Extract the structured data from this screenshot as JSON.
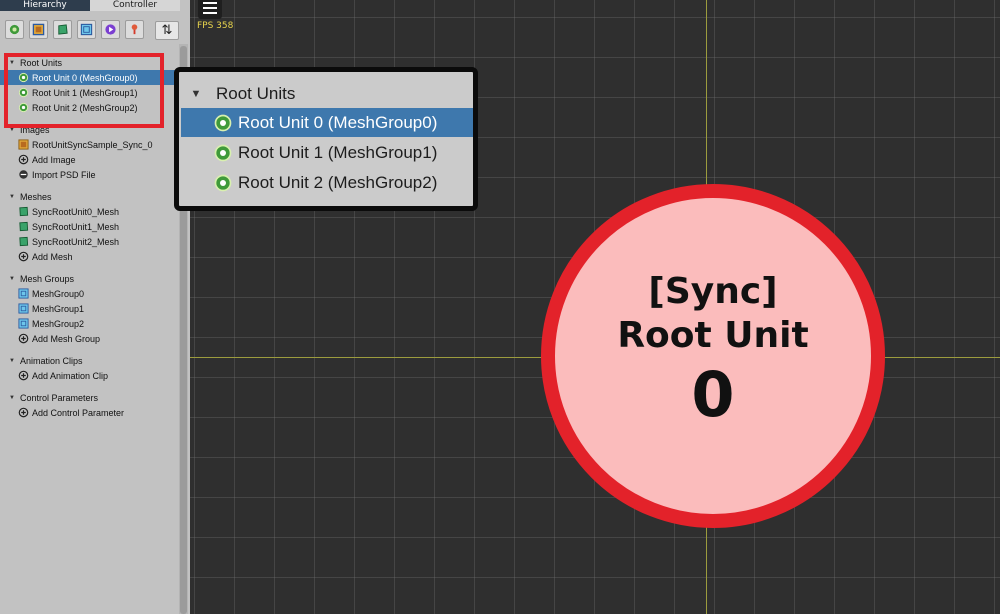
{
  "tabs": [
    {
      "label": "Hierarchy",
      "active": true
    },
    {
      "label": "Controller",
      "active": false
    }
  ],
  "toolbar": {
    "buttons": [
      "root-unit-filter-icon",
      "image-filter-icon",
      "mesh-filter-icon",
      "mesh-group-filter-icon",
      "animation-filter-icon",
      "control-param-filter-icon"
    ],
    "sort_label": "⇅"
  },
  "viewport": {
    "fps_label": "FPS 358"
  },
  "hierarchy": {
    "root_units": {
      "title": "Root Units",
      "items": [
        "Root Unit 0 (MeshGroup0)",
        "Root Unit 1 (MeshGroup1)",
        "Root Unit 2 (MeshGroup2)"
      ],
      "selected_index": 0
    },
    "images": {
      "title": "Images",
      "items": [
        "RootUnitSyncSample_Sync_0"
      ],
      "add": "Add Image",
      "extra": "Import PSD File"
    },
    "meshes": {
      "title": "Meshes",
      "items": [
        "SyncRootUnit0_Mesh",
        "SyncRootUnit1_Mesh",
        "SyncRootUnit2_Mesh"
      ],
      "add": "Add Mesh"
    },
    "mesh_groups": {
      "title": "Mesh Groups",
      "items": [
        "MeshGroup0",
        "MeshGroup1",
        "MeshGroup2"
      ],
      "add": "Add Mesh Group"
    },
    "animation_clips": {
      "title": "Animation Clips",
      "add": "Add Animation Clip"
    },
    "control_parameters": {
      "title": "Control Parameters",
      "add": "Add Control Parameter"
    }
  },
  "badge": {
    "line1": "[Sync]",
    "line2": "Root Unit",
    "line3": "0"
  },
  "colors": {
    "selection": "#3e78ad",
    "highlight_red": "#e3222a",
    "badge_fill": "#fbbcbc",
    "fps": "#e8d44d"
  }
}
